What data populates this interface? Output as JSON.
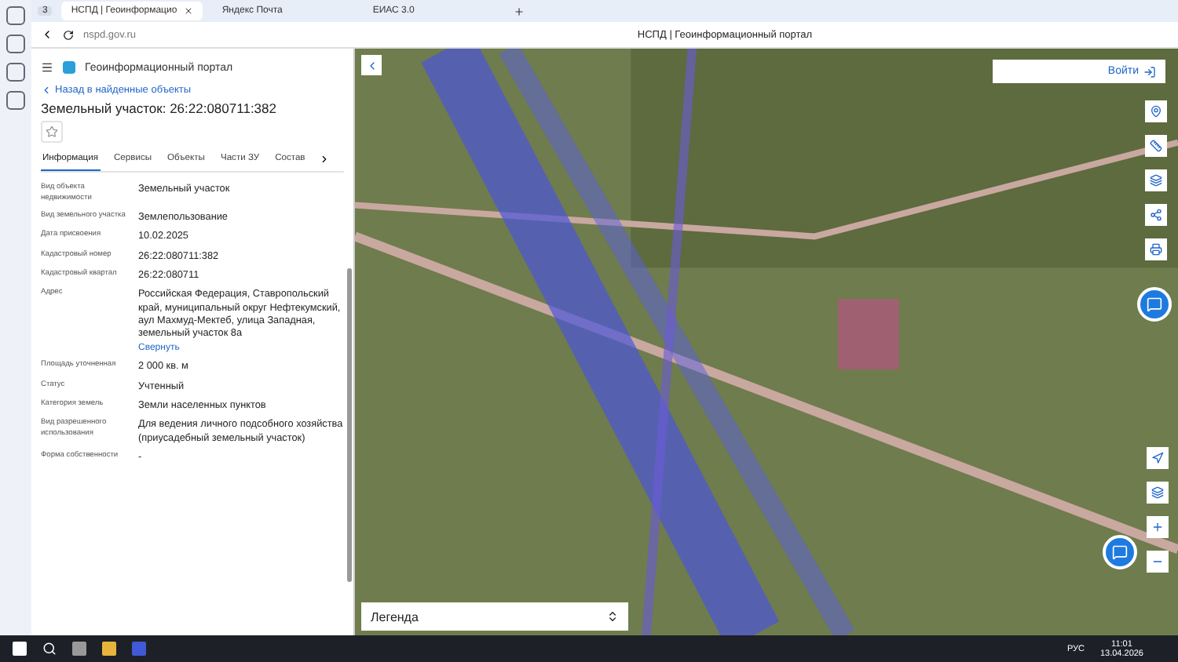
{
  "browser": {
    "tab_count": "3",
    "tabs": [
      {
        "title": "НСПД | Геоинформацио",
        "selected": true,
        "closable": true
      },
      {
        "title": "Яндекс Почта",
        "selected": false,
        "closable": false
      },
      {
        "title": "ЕИАС 3.0",
        "selected": false,
        "closable": false
      }
    ],
    "address": "nspd.gov.ru",
    "page_title": "НСПД | Геоинформационный портал"
  },
  "portal": {
    "title": "Геоинформационный портал",
    "back_link": "Назад в найденные объекты",
    "object_title": "Земельный участок: 26:22:080711:382",
    "tabs": [
      {
        "label": "Информация",
        "selected": true
      },
      {
        "label": "Сервисы",
        "selected": false
      },
      {
        "label": "Объекты",
        "selected": false
      },
      {
        "label": "Части ЗУ",
        "selected": false
      },
      {
        "label": "Состав",
        "selected": false
      }
    ],
    "fields": [
      {
        "label": "Вид объекта недвижимости",
        "value": "Земельный участок"
      },
      {
        "label": "Вид земельного участка",
        "value": "Землепользование"
      },
      {
        "label": "Дата присвоения",
        "value": "10.02.2025"
      },
      {
        "label": "Кадастровый номер",
        "value": "26:22:080711:382"
      },
      {
        "label": "Кадастровый квартал",
        "value": "26:22:080711"
      },
      {
        "label": "Адрес",
        "value": "Российская Федерация, Ставропольский край, муниципальный округ Нефтекумский, аул Махмуд-Мектеб, улица Западная, земельный участок 8а",
        "link": "Свернуть"
      },
      {
        "label": "Площадь уточненная",
        "value": "2 000 кв. м"
      },
      {
        "label": "Статус",
        "value": "Учтенный"
      },
      {
        "label": "Категория земель",
        "value": "Земли населенных пунктов"
      },
      {
        "label": "Вид разрешенного использования",
        "value": "Для ведения личного подсобного хозяйства (приусадебный земельный участок)"
      },
      {
        "label": "Форма собственности",
        "value": "-"
      }
    ]
  },
  "map": {
    "login": "Войти",
    "legend": "Легенда"
  },
  "taskbar": {
    "language": "РУС",
    "time": "11:01",
    "date": "13.04.2026"
  }
}
